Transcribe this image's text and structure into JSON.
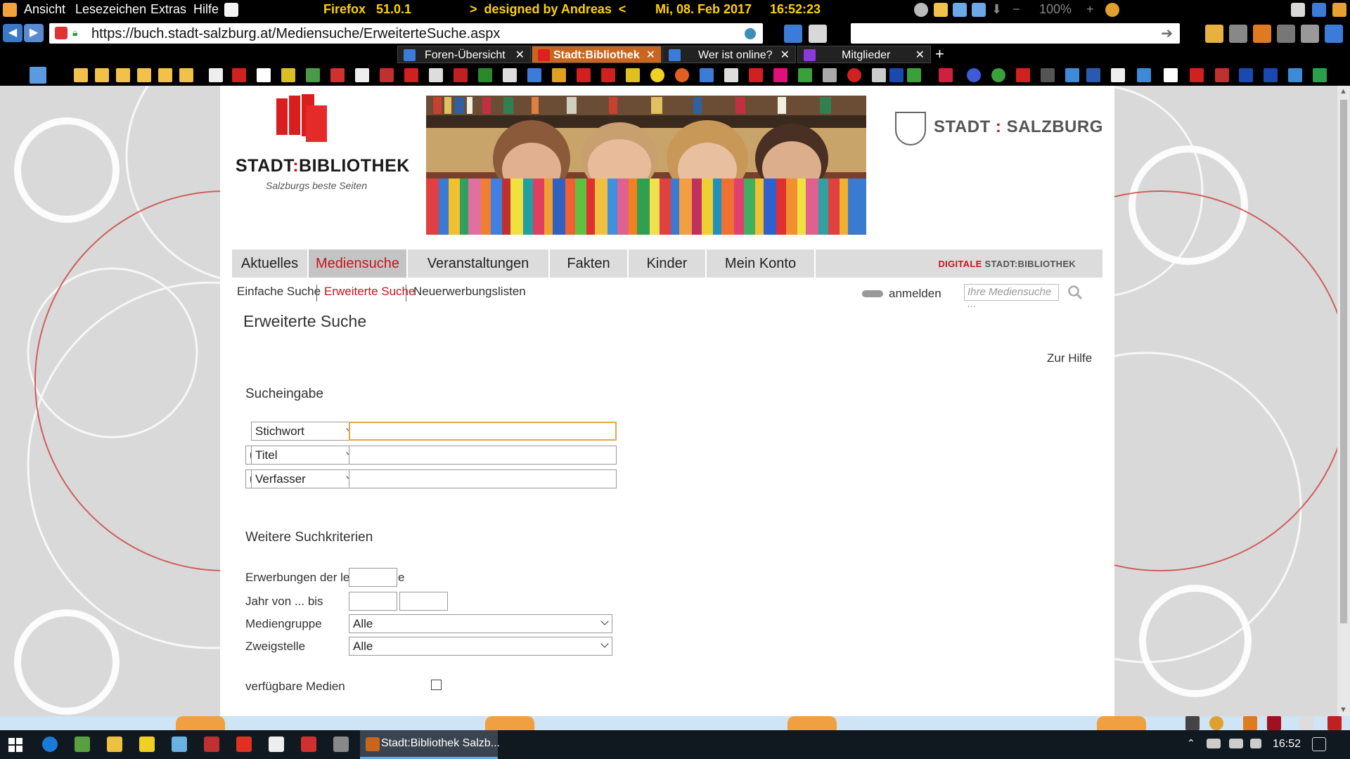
{
  "menubar": {
    "items": [
      "Ansicht",
      "Lesezeichen",
      "Extras",
      "Hilfe"
    ],
    "browser_name": "Firefox",
    "browser_version": "51.0.1",
    "designed_by": ">  designed by Andreas  <",
    "date": "Mi, 08. Feb 2017",
    "time": "16:52:23",
    "zoom": "100%"
  },
  "navbar": {
    "url": "https://buch.stadt-salzburg.at/Mediensuche/ErweiterteSuche.aspx",
    "search_placeholder": ""
  },
  "tabs": [
    {
      "label": "Foren-Übersicht",
      "active": false
    },
    {
      "label": "Stadt:Bibliothek",
      "active": true
    },
    {
      "label": "Wer ist online?",
      "active": false
    },
    {
      "label": "Mitglieder",
      "active": false
    }
  ],
  "site": {
    "brand_name_a": "STADT",
    "brand_colon": ":",
    "brand_name_b": "BIBLIOTHEK",
    "brand_tagline": "Salzburgs beste Seiten",
    "city_a": "STADT",
    "city_colon": ":",
    "city_b": "SALZBURG",
    "main_nav": [
      "Aktuelles",
      "Mediensuche",
      "Veranstaltungen",
      "Fakten",
      "Kinder",
      "Mein Konto"
    ],
    "digitale_red": "DIGITALE",
    "digitale_rest": " STADT:BIBLIOTHEK",
    "sub_nav": [
      "Einfache Suche",
      "Erweiterte Suche",
      "Neuerwerbungslisten"
    ],
    "login_label": "anmelden",
    "quick_search_placeholder": "Ihre Mediensuche ..."
  },
  "page": {
    "title": "Erweiterte Suche",
    "help_link": "Zur Hilfe",
    "section_search": "Sucheingabe",
    "rows": [
      {
        "op": "",
        "field": "Stichwort",
        "value": ""
      },
      {
        "op": "und",
        "field": "Titel",
        "value": ""
      },
      {
        "op": "und",
        "field": "Verfasser",
        "value": ""
      }
    ],
    "section_more": "Weitere Suchkriterien",
    "acq_label": "Erwerbungen der letzten Tage",
    "year_label": "Jahr von ... bis",
    "media_label": "Mediengruppe",
    "media_value": "Alle",
    "branch_label": "Zweigstelle",
    "branch_value": "Alle",
    "available_label": "verfügbare Medien"
  },
  "taskbar": {
    "active_window": "Stadt:Bibliothek Salzb...",
    "clock": "16:52"
  },
  "colors": {
    "brand_red": "#c8141d",
    "nav_gray": "#dcdcdc",
    "focus_border": "#e0a84a"
  }
}
